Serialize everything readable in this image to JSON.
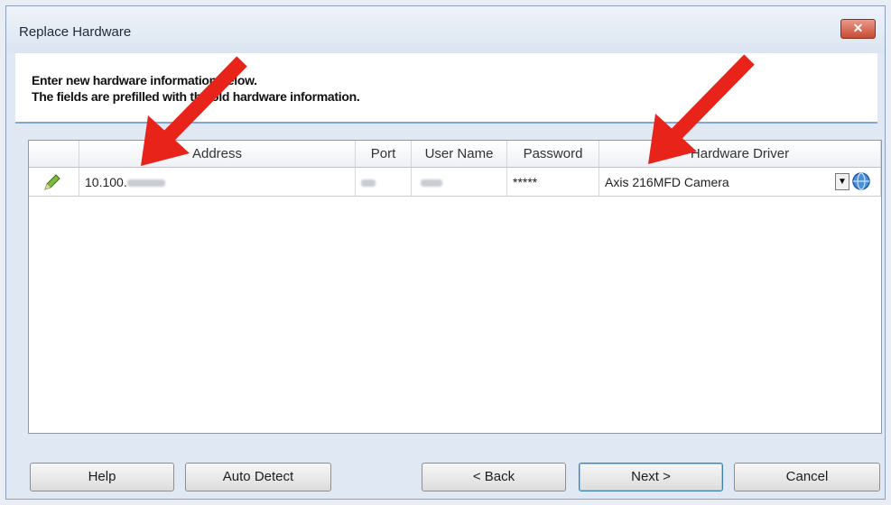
{
  "window": {
    "title": "Replace Hardware",
    "close_symbol": "✕"
  },
  "instructions": {
    "line1": "Enter new hardware information below.",
    "line2": "The fields are prefilled with the old hardware information."
  },
  "grid": {
    "columns": [
      "",
      "Address",
      "Port",
      "User Name",
      "Password",
      "Hardware Driver"
    ],
    "row": {
      "address_prefix": "10.100.",
      "password": "*****",
      "driver": "Axis 216MFD Camera"
    }
  },
  "buttons": {
    "help": "Help",
    "auto_detect": "Auto Detect",
    "back": "< Back",
    "next": "Next >",
    "cancel": "Cancel"
  },
  "colors": {
    "annotation_arrow": "#e8231a",
    "accent": "#7fa6d6"
  },
  "icons": [
    "pencil-icon",
    "dropdown-arrow-icon",
    "browser-globe-icon",
    "close-icon"
  ]
}
